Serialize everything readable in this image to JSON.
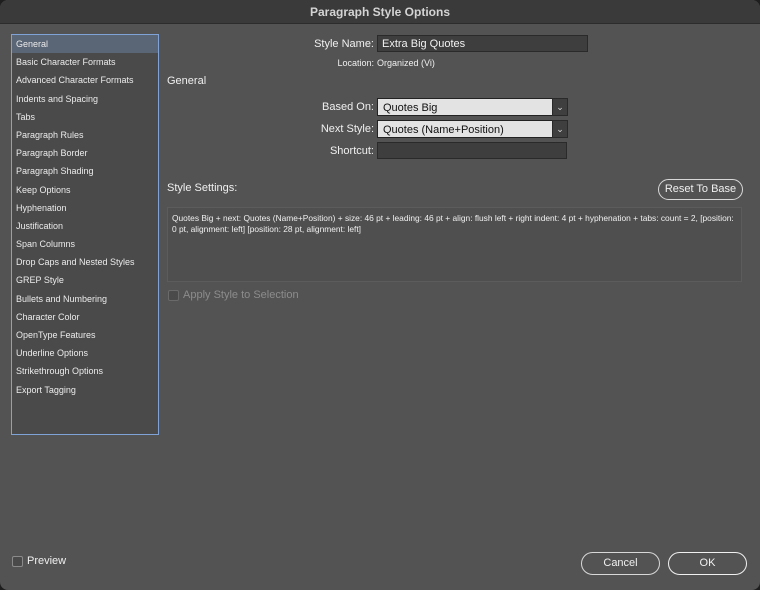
{
  "window": {
    "title": "Paragraph Style Options"
  },
  "sidebar": {
    "items": [
      {
        "label": "General",
        "selected": true
      },
      {
        "label": "Basic Character Formats"
      },
      {
        "label": "Advanced Character Formats"
      },
      {
        "label": "Indents and Spacing"
      },
      {
        "label": "Tabs"
      },
      {
        "label": "Paragraph Rules"
      },
      {
        "label": "Paragraph Border"
      },
      {
        "label": "Paragraph Shading"
      },
      {
        "label": "Keep Options"
      },
      {
        "label": "Hyphenation"
      },
      {
        "label": "Justification"
      },
      {
        "label": "Span Columns"
      },
      {
        "label": "Drop Caps and Nested Styles"
      },
      {
        "label": "GREP Style"
      },
      {
        "label": "Bullets and Numbering"
      },
      {
        "label": "Character Color"
      },
      {
        "label": "OpenType Features"
      },
      {
        "label": "Underline Options"
      },
      {
        "label": "Strikethrough Options"
      },
      {
        "label": "Export Tagging"
      }
    ]
  },
  "form": {
    "style_name_label": "Style Name:",
    "style_name_value": "Extra Big Quotes",
    "location_label": "Location:",
    "location_value": "Organized (Vi)",
    "section_heading": "General",
    "based_on_label": "Based On:",
    "based_on_value": "Quotes Big",
    "next_style_label": "Next Style:",
    "next_style_value": "Quotes (Name+Position)",
    "shortcut_label": "Shortcut:",
    "shortcut_value": "",
    "style_settings_label": "Style Settings:",
    "reset_button": "Reset To Base",
    "style_settings_text": "Quotes Big + next: Quotes (Name+Position) + size: 46 pt + leading: 46 pt + align: flush left + right indent: 4 pt + hyphenation + tabs: count = 2, [position: 0 pt, alignment: left] [position: 28 pt, alignment: left]",
    "apply_style_label": "Apply Style to Selection"
  },
  "footer": {
    "preview_label": "Preview",
    "cancel_button": "Cancel",
    "ok_button": "OK"
  },
  "icons": {
    "dropdown": "chevron-down-icon"
  },
  "colors": {
    "dialog_bg": "#535353",
    "selection": "#5a6575",
    "sidebar_border": "#7fa3d6"
  }
}
